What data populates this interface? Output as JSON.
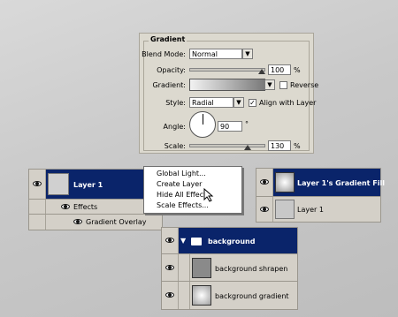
{
  "gradient_panel": {
    "title": "Gradient",
    "blend_mode_label": "Blend Mode:",
    "blend_mode_value": "Normal",
    "opacity_label": "Opacity:",
    "opacity_value": "100",
    "opacity_unit": "%",
    "opacity_level": 1.0,
    "gradient_label": "Gradient:",
    "reverse_label": "Reverse",
    "reverse_checked": false,
    "style_label": "Style:",
    "style_value": "Radial",
    "align_label": "Align with Layer",
    "align_checked": true,
    "angle_label": "Angle:",
    "angle_value": "90",
    "angle_unit": "°",
    "scale_label": "Scale:",
    "scale_value": "130",
    "scale_unit": "%",
    "scale_level": 0.87
  },
  "left_layers": {
    "layer_name": "Layer 1",
    "effects_label": "Effects",
    "effect_item": "Gradient Overlay"
  },
  "context_menu": {
    "items": [
      "Global Light...",
      "Create Layer",
      "Hide All Effects",
      "Scale Effects..."
    ]
  },
  "right_layers": {
    "gradient_fill_layer": "Layer 1's Gradient Fill",
    "base_layer": "Layer 1"
  },
  "bottom_layers": {
    "group_name": "background",
    "layer_1": "background shrapen",
    "layer_2": "background gradient"
  },
  "colors": {
    "selection": "#0a246a",
    "panel": "#dcd9cf"
  }
}
